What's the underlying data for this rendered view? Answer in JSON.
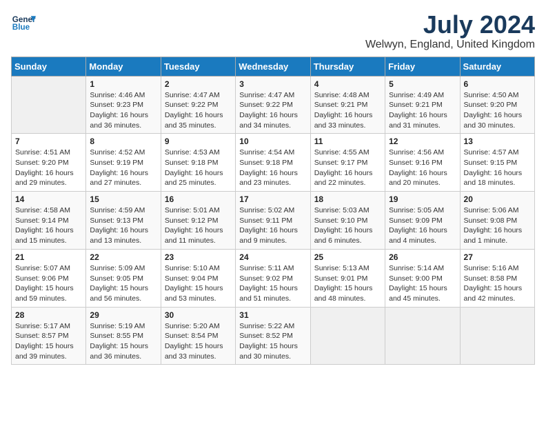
{
  "logo": {
    "line1": "General",
    "line2": "Blue"
  },
  "title": "July 2024",
  "subtitle": "Welwyn, England, United Kingdom",
  "headers": [
    "Sunday",
    "Monday",
    "Tuesday",
    "Wednesday",
    "Thursday",
    "Friday",
    "Saturday"
  ],
  "weeks": [
    [
      {
        "day": "",
        "details": ""
      },
      {
        "day": "1",
        "details": "Sunrise: 4:46 AM\nSunset: 9:23 PM\nDaylight: 16 hours\nand 36 minutes."
      },
      {
        "day": "2",
        "details": "Sunrise: 4:47 AM\nSunset: 9:22 PM\nDaylight: 16 hours\nand 35 minutes."
      },
      {
        "day": "3",
        "details": "Sunrise: 4:47 AM\nSunset: 9:22 PM\nDaylight: 16 hours\nand 34 minutes."
      },
      {
        "day": "4",
        "details": "Sunrise: 4:48 AM\nSunset: 9:21 PM\nDaylight: 16 hours\nand 33 minutes."
      },
      {
        "day": "5",
        "details": "Sunrise: 4:49 AM\nSunset: 9:21 PM\nDaylight: 16 hours\nand 31 minutes."
      },
      {
        "day": "6",
        "details": "Sunrise: 4:50 AM\nSunset: 9:20 PM\nDaylight: 16 hours\nand 30 minutes."
      }
    ],
    [
      {
        "day": "7",
        "details": "Sunrise: 4:51 AM\nSunset: 9:20 PM\nDaylight: 16 hours\nand 29 minutes."
      },
      {
        "day": "8",
        "details": "Sunrise: 4:52 AM\nSunset: 9:19 PM\nDaylight: 16 hours\nand 27 minutes."
      },
      {
        "day": "9",
        "details": "Sunrise: 4:53 AM\nSunset: 9:18 PM\nDaylight: 16 hours\nand 25 minutes."
      },
      {
        "day": "10",
        "details": "Sunrise: 4:54 AM\nSunset: 9:18 PM\nDaylight: 16 hours\nand 23 minutes."
      },
      {
        "day": "11",
        "details": "Sunrise: 4:55 AM\nSunset: 9:17 PM\nDaylight: 16 hours\nand 22 minutes."
      },
      {
        "day": "12",
        "details": "Sunrise: 4:56 AM\nSunset: 9:16 PM\nDaylight: 16 hours\nand 20 minutes."
      },
      {
        "day": "13",
        "details": "Sunrise: 4:57 AM\nSunset: 9:15 PM\nDaylight: 16 hours\nand 18 minutes."
      }
    ],
    [
      {
        "day": "14",
        "details": "Sunrise: 4:58 AM\nSunset: 9:14 PM\nDaylight: 16 hours\nand 15 minutes."
      },
      {
        "day": "15",
        "details": "Sunrise: 4:59 AM\nSunset: 9:13 PM\nDaylight: 16 hours\nand 13 minutes."
      },
      {
        "day": "16",
        "details": "Sunrise: 5:01 AM\nSunset: 9:12 PM\nDaylight: 16 hours\nand 11 minutes."
      },
      {
        "day": "17",
        "details": "Sunrise: 5:02 AM\nSunset: 9:11 PM\nDaylight: 16 hours\nand 9 minutes."
      },
      {
        "day": "18",
        "details": "Sunrise: 5:03 AM\nSunset: 9:10 PM\nDaylight: 16 hours\nand 6 minutes."
      },
      {
        "day": "19",
        "details": "Sunrise: 5:05 AM\nSunset: 9:09 PM\nDaylight: 16 hours\nand 4 minutes."
      },
      {
        "day": "20",
        "details": "Sunrise: 5:06 AM\nSunset: 9:08 PM\nDaylight: 16 hours\nand 1 minute."
      }
    ],
    [
      {
        "day": "21",
        "details": "Sunrise: 5:07 AM\nSunset: 9:06 PM\nDaylight: 15 hours\nand 59 minutes."
      },
      {
        "day": "22",
        "details": "Sunrise: 5:09 AM\nSunset: 9:05 PM\nDaylight: 15 hours\nand 56 minutes."
      },
      {
        "day": "23",
        "details": "Sunrise: 5:10 AM\nSunset: 9:04 PM\nDaylight: 15 hours\nand 53 minutes."
      },
      {
        "day": "24",
        "details": "Sunrise: 5:11 AM\nSunset: 9:02 PM\nDaylight: 15 hours\nand 51 minutes."
      },
      {
        "day": "25",
        "details": "Sunrise: 5:13 AM\nSunset: 9:01 PM\nDaylight: 15 hours\nand 48 minutes."
      },
      {
        "day": "26",
        "details": "Sunrise: 5:14 AM\nSunset: 9:00 PM\nDaylight: 15 hours\nand 45 minutes."
      },
      {
        "day": "27",
        "details": "Sunrise: 5:16 AM\nSunset: 8:58 PM\nDaylight: 15 hours\nand 42 minutes."
      }
    ],
    [
      {
        "day": "28",
        "details": "Sunrise: 5:17 AM\nSunset: 8:57 PM\nDaylight: 15 hours\nand 39 minutes."
      },
      {
        "day": "29",
        "details": "Sunrise: 5:19 AM\nSunset: 8:55 PM\nDaylight: 15 hours\nand 36 minutes."
      },
      {
        "day": "30",
        "details": "Sunrise: 5:20 AM\nSunset: 8:54 PM\nDaylight: 15 hours\nand 33 minutes."
      },
      {
        "day": "31",
        "details": "Sunrise: 5:22 AM\nSunset: 8:52 PM\nDaylight: 15 hours\nand 30 minutes."
      },
      {
        "day": "",
        "details": ""
      },
      {
        "day": "",
        "details": ""
      },
      {
        "day": "",
        "details": ""
      }
    ]
  ]
}
